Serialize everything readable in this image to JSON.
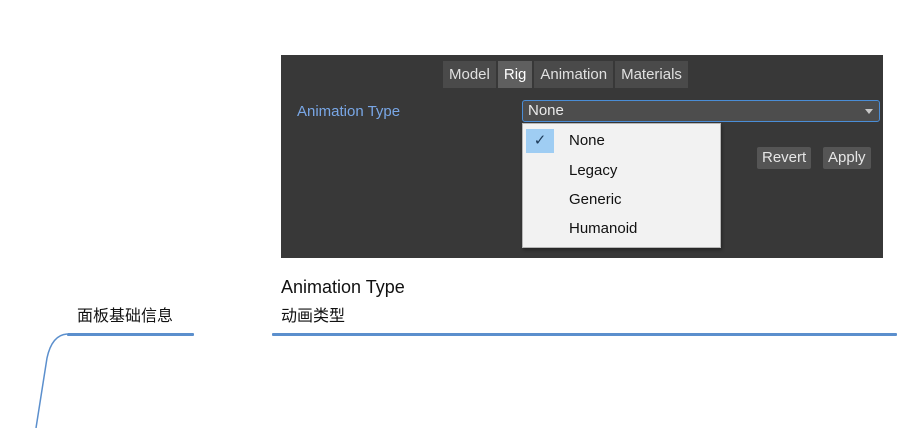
{
  "panel": {
    "tabs": [
      {
        "label": "Model",
        "active": false
      },
      {
        "label": "Rig",
        "active": true
      },
      {
        "label": "Animation",
        "active": false
      },
      {
        "label": "Materials",
        "active": false
      }
    ],
    "animation_type_label": "Animation Type",
    "dropdown_value": "None",
    "revert_label": "Revert",
    "apply_label": "Apply"
  },
  "menu": {
    "items": [
      {
        "label": "None",
        "checked": true,
        "check_glyph": "✓"
      },
      {
        "label": "Legacy",
        "checked": false
      },
      {
        "label": "Generic",
        "checked": false
      },
      {
        "label": "Humanoid",
        "checked": false
      }
    ]
  },
  "annotations": {
    "section_title": "Animation Type",
    "section_subtitle": "动画类型",
    "left_label": "面板基础信息"
  },
  "colors": {
    "panel_bg": "#383838",
    "label_blue": "#79a7e6",
    "accent_line": "#5b8fcd",
    "selected_bg": "#9fcdf3"
  }
}
